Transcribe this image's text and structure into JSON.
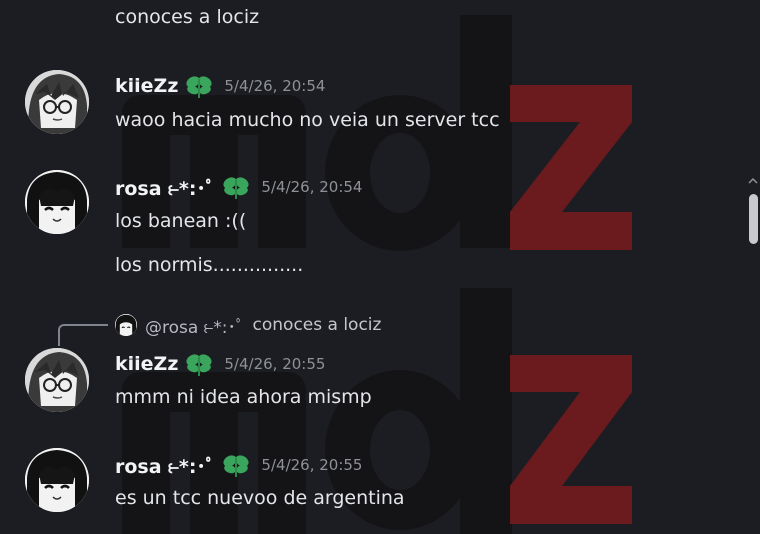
{
  "messages": {
    "continued_top": {
      "text": "conoces a lociz"
    },
    "m1": {
      "username": "kiieZz",
      "timestamp": "5/4/26, 20:54",
      "text": "waoo hacia mucho no veia un server tcc"
    },
    "m2": {
      "username": "rosa ⥼*:･ﾟ",
      "timestamp": "5/4/26, 20:54",
      "text": "los banean :((",
      "text2": "los normis..............."
    },
    "m3": {
      "reply_mention": "@rosa ⥼*:･ﾟ",
      "reply_text": "conoces a lociz",
      "username": "kiieZz",
      "timestamp": "5/4/26, 20:55",
      "text": "mmm ni idea ahora mismp"
    },
    "m4": {
      "username": "rosa ⥼*:･ﾟ",
      "timestamp": "5/4/26, 20:55",
      "text": "es un tcc nuevoo de argentina"
    }
  },
  "icons": {
    "badge": "green-leaf-badge-icon",
    "avatar_kiiezz": "anime-avatar-glasses",
    "avatar_rosa": "anime-avatar-girl"
  },
  "colors": {
    "background": "#1c1d22",
    "badge_green": "#3aa55c",
    "timestamp": "#8e9297",
    "watermark_dark": "#141417",
    "watermark_red": "#6b1a1e"
  }
}
